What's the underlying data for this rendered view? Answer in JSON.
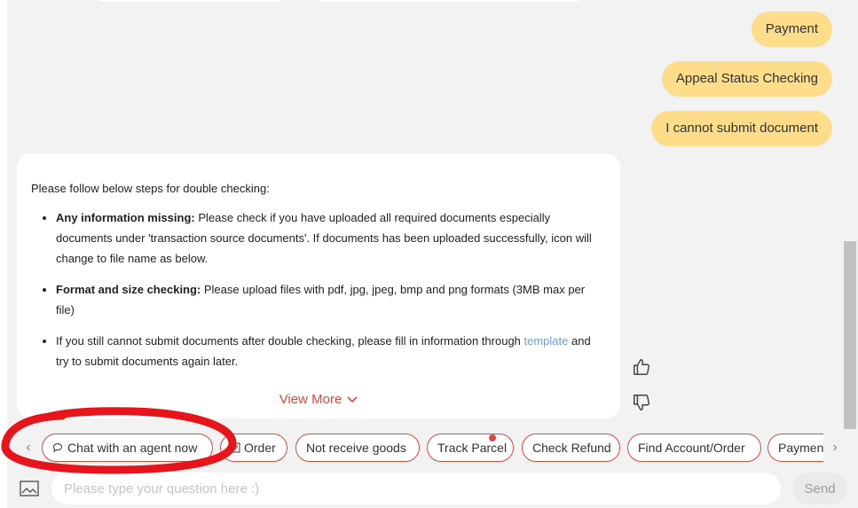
{
  "user_messages": [
    "Payment",
    "Appeal Status Checking",
    "I cannot submit document"
  ],
  "bot_message": {
    "intro": "Please follow below steps for double checking:",
    "items": [
      {
        "bold": "Any information missing:",
        "text": " Please check if you have uploaded all required documents especially documents under 'transaction source documents'. If documents has been uploaded successfully, icon will change to file name as below."
      },
      {
        "bold": "Format and size checking:",
        "text": " Please upload files with pdf, jpg, jpeg, bmp and png formats (3MB max per file)"
      },
      {
        "text_before": "If you still cannot submit documents after double checking, please fill in information through ",
        "link": "template",
        "text_after": " and try to submit documents again later."
      }
    ],
    "view_more": "View More"
  },
  "quick_replies": [
    "Chat with an agent now",
    "Order",
    "Not receive goods",
    "Track Parcel",
    "Check Refund",
    "Find Account/Order",
    "Paymen"
  ],
  "input": {
    "placeholder": "Please type your question here :)",
    "send_label": "Send"
  },
  "colors": {
    "accent": "#e0473f",
    "user_bubble": "#fddc8a",
    "annotation": "#e8141c"
  },
  "icons": [
    "thumbs-up-icon",
    "thumbs-down-icon",
    "chat-bubble-icon",
    "order-icon",
    "chevron-left-icon",
    "chevron-right-icon",
    "chevron-down-icon",
    "image-upload-icon"
  ]
}
